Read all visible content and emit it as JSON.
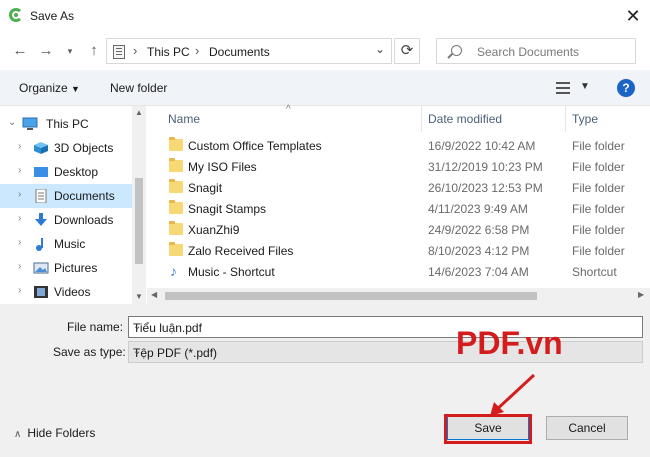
{
  "window": {
    "title": "Save As"
  },
  "nav": {
    "back": "←",
    "forward": "→",
    "up": "↑",
    "refresh": "⟳"
  },
  "address": {
    "crumbs": [
      "This PC",
      "Documents"
    ]
  },
  "search": {
    "placeholder": "Search Documents"
  },
  "toolbar": {
    "organize": "Organize",
    "new_folder": "New folder",
    "help": "?"
  },
  "sidebar": {
    "items": [
      {
        "label": "This PC",
        "icon": "computer-icon"
      },
      {
        "label": "3D Objects",
        "icon": "cube-icon"
      },
      {
        "label": "Desktop",
        "icon": "desktop-icon"
      },
      {
        "label": "Documents",
        "icon": "document-icon",
        "selected": true
      },
      {
        "label": "Downloads",
        "icon": "download-icon"
      },
      {
        "label": "Music",
        "icon": "music-icon"
      },
      {
        "label": "Pictures",
        "icon": "picture-icon"
      },
      {
        "label": "Videos",
        "icon": "video-icon"
      }
    ]
  },
  "columns": {
    "name": "Name",
    "date": "Date modified",
    "type": "Type"
  },
  "files": [
    {
      "name": "Custom Office Templates",
      "date": "16/9/2022 10:42 AM",
      "type": "File folder",
      "icon": "folder-icon"
    },
    {
      "name": "My ISO Files",
      "date": "31/12/2019 10:23 PM",
      "type": "File folder",
      "icon": "folder-icon"
    },
    {
      "name": "Snagit",
      "date": "26/10/2023 12:53 PM",
      "type": "File folder",
      "icon": "folder-icon"
    },
    {
      "name": "Snagit Stamps",
      "date": "4/11/2023 9:49 AM",
      "type": "File folder",
      "icon": "folder-icon"
    },
    {
      "name": "XuanZhi9",
      "date": "24/9/2022 6:58 PM",
      "type": "File folder",
      "icon": "folder-icon"
    },
    {
      "name": "Zalo Received Files",
      "date": "8/10/2023 4:12 PM",
      "type": "File folder",
      "icon": "folder-icon"
    },
    {
      "name": "Music - Shortcut",
      "date": "14/6/2023 7:04 AM",
      "type": "Shortcut",
      "icon": "music-shortcut-icon"
    }
  ],
  "form": {
    "file_name_label": "File name:",
    "file_name_value": "Tiểu luận.pdf",
    "save_type_label": "Save as type:",
    "save_type_value": "Tệp PDF (*.pdf)"
  },
  "footer": {
    "hide_folders": "Hide Folders",
    "save": "Save",
    "cancel": "Cancel"
  },
  "watermark": "PDF.vn",
  "colors": {
    "accent": "#0078d7",
    "highlight": "#d51c1c",
    "selected_bg": "#cce8ff"
  }
}
